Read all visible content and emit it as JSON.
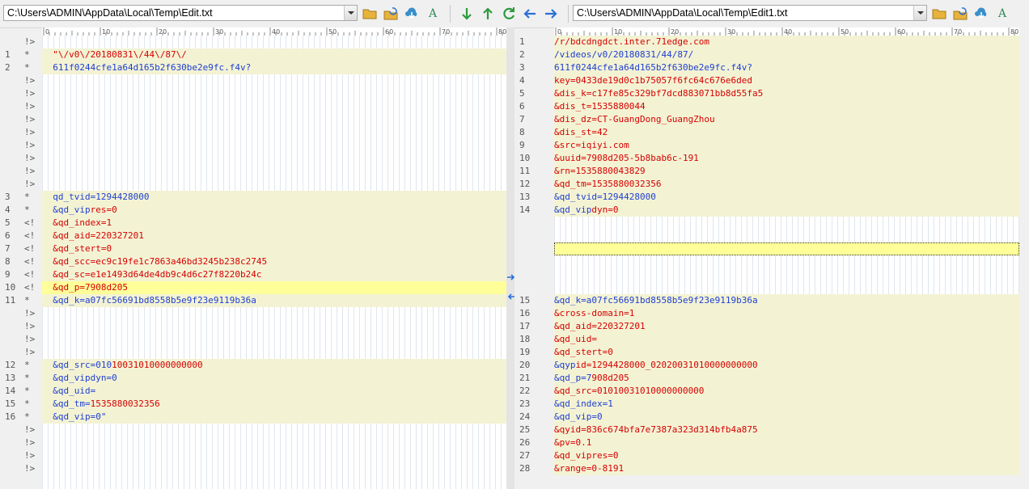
{
  "left": {
    "path": "C:\\Users\\ADMIN\\AppData\\Local\\Temp\\Edit.txt",
    "rows": [
      {
        "n": "",
        "m": "!>",
        "t": "blank",
        "k": "",
        "v": ""
      },
      {
        "n": "1",
        "m": "*",
        "t": "line",
        "k": "",
        "v": "  \"\\/v0\\/20180831\\/44\\/87\\/"
      },
      {
        "n": "2",
        "m": "*",
        "t": "line",
        "k": "  611f0244cfe1a64d165b2f630be2e9fc.f4v?",
        "v": ""
      },
      {
        "n": "",
        "m": "!>",
        "t": "blank",
        "k": "",
        "v": ""
      },
      {
        "n": "",
        "m": "!>",
        "t": "blank",
        "k": "",
        "v": ""
      },
      {
        "n": "",
        "m": "!>",
        "t": "blank",
        "k": "",
        "v": ""
      },
      {
        "n": "",
        "m": "!>",
        "t": "blank",
        "k": "",
        "v": ""
      },
      {
        "n": "",
        "m": "!>",
        "t": "blank",
        "k": "",
        "v": ""
      },
      {
        "n": "",
        "m": "!>",
        "t": "blank",
        "k": "",
        "v": ""
      },
      {
        "n": "",
        "m": "!>",
        "t": "blank",
        "k": "",
        "v": ""
      },
      {
        "n": "",
        "m": "!>",
        "t": "blank",
        "k": "",
        "v": ""
      },
      {
        "n": "",
        "m": "!>",
        "t": "blank",
        "k": "",
        "v": ""
      },
      {
        "n": "3",
        "m": "*",
        "t": "line",
        "k": "  qd_tvid=1294428000",
        "v": ""
      },
      {
        "n": "4",
        "m": "*",
        "t": "line",
        "k": "  &qd_vip",
        "v": "res=0"
      },
      {
        "n": "5",
        "m": "<!",
        "t": "line",
        "k": "",
        "v": "  &qd_index=1"
      },
      {
        "n": "6",
        "m": "<!",
        "t": "line",
        "k": "",
        "v": "  &qd_aid=220327201"
      },
      {
        "n": "7",
        "m": "<!",
        "t": "line",
        "k": "",
        "v": "  &qd_stert=0"
      },
      {
        "n": "8",
        "m": "<!",
        "t": "line",
        "k": "",
        "v": "  &qd_scc=ec9c19fe1c7863a46bd3245b238c2745"
      },
      {
        "n": "9",
        "m": "<!",
        "t": "line",
        "k": "",
        "v": "  &qd_sc=e1e1493d64de4db9c4d6c27f8220b24c"
      },
      {
        "n": "10",
        "m": "<!",
        "t": "hl",
        "k": "",
        "v": "  &qd_p=7908d205"
      },
      {
        "n": "11",
        "m": "*",
        "t": "line",
        "k": "  &qd_k=a07fc56691bd8558b5e9f23e9119b36a",
        "v": ""
      },
      {
        "n": "",
        "m": "!>",
        "t": "blank",
        "k": "",
        "v": ""
      },
      {
        "n": "",
        "m": "!>",
        "t": "blank",
        "k": "",
        "v": ""
      },
      {
        "n": "",
        "m": "!>",
        "t": "blank",
        "k": "",
        "v": ""
      },
      {
        "n": "",
        "m": "!>",
        "t": "blank",
        "k": "",
        "v": ""
      },
      {
        "n": "12",
        "m": "*",
        "t": "line",
        "k": "  &qd_src=010",
        "v": "10031010000000000"
      },
      {
        "n": "13",
        "m": "*",
        "t": "line",
        "k": "  &qd_vipdyn=0",
        "v": ""
      },
      {
        "n": "14",
        "m": "*",
        "t": "line",
        "k": "  &qd_uid=",
        "v": ""
      },
      {
        "n": "15",
        "m": "*",
        "t": "line",
        "k": "  &qd_tm=",
        "v": "1535880032356"
      },
      {
        "n": "16",
        "m": "*",
        "t": "line",
        "k": "  &qd_vip=0\"",
        "v": ""
      },
      {
        "n": "",
        "m": "!>",
        "t": "blank",
        "k": "",
        "v": ""
      },
      {
        "n": "",
        "m": "!>",
        "t": "blank",
        "k": "",
        "v": ""
      },
      {
        "n": "",
        "m": "!>",
        "t": "blank",
        "k": "",
        "v": ""
      },
      {
        "n": "",
        "m": "!>",
        "t": "blank",
        "k": "",
        "v": ""
      }
    ]
  },
  "right": {
    "path": "C:\\Users\\ADMIN\\AppData\\Local\\Temp\\Edit1.txt",
    "rows": [
      {
        "n": "1",
        "t": "line",
        "k": "",
        "v": "/r/bdcdngdct.inter.71edge.com"
      },
      {
        "n": "2",
        "t": "line",
        "k": "/videos/v0/20180831/44/87/",
        "v": ""
      },
      {
        "n": "3",
        "t": "line",
        "k": "611f0244cfe1a64d165b2f630be2e9fc.f4v?",
        "v": ""
      },
      {
        "n": "4",
        "t": "line",
        "k": "",
        "v": "key=0433de19d0c1b75057f6fc64c676e6ded"
      },
      {
        "n": "5",
        "t": "line",
        "k": "",
        "v": "&dis_k=c17fe85c329bf7dcd883071bb8d55fa5"
      },
      {
        "n": "6",
        "t": "line",
        "k": "",
        "v": "&dis_t=1535880044"
      },
      {
        "n": "7",
        "t": "line",
        "k": "",
        "v": "&dis_dz=CT-GuangDong_GuangZhou"
      },
      {
        "n": "8",
        "t": "line",
        "k": "",
        "v": "&dis_st=42"
      },
      {
        "n": "9",
        "t": "line",
        "k": "",
        "v": "&src=iqiyi.com"
      },
      {
        "n": "10",
        "t": "line",
        "k": "",
        "v": "&uuid=7908d205-5b8bab6c-191"
      },
      {
        "n": "11",
        "t": "line",
        "k": "",
        "v": "&rn=1535880043829"
      },
      {
        "n": "12",
        "t": "line",
        "k": "",
        "v": "&qd_tm=1535880032356"
      },
      {
        "n": "13",
        "t": "line",
        "k": "&qd_tvid=1294428000",
        "v": ""
      },
      {
        "n": "14",
        "t": "line",
        "k": "&qd_vip",
        "v": "dyn=0"
      },
      {
        "n": "",
        "t": "blank",
        "k": "",
        "v": ""
      },
      {
        "n": "",
        "t": "blank",
        "k": "",
        "v": ""
      },
      {
        "n": "",
        "t": "focus",
        "k": "",
        "v": ""
      },
      {
        "n": "",
        "t": "blank",
        "k": "",
        "v": ""
      },
      {
        "n": "",
        "t": "blank",
        "k": "",
        "v": ""
      },
      {
        "n": "",
        "t": "blank",
        "k": "",
        "v": ""
      },
      {
        "n": "15",
        "t": "line",
        "k": "&qd_k=a07fc56691bd8558b5e9f23e9119b36a",
        "v": ""
      },
      {
        "n": "16",
        "t": "line",
        "k": "",
        "v": "&cross-domain=1"
      },
      {
        "n": "17",
        "t": "line",
        "k": "",
        "v": "&qd_aid=220327201"
      },
      {
        "n": "18",
        "t": "line",
        "k": "",
        "v": "&qd_uid="
      },
      {
        "n": "19",
        "t": "line",
        "k": "",
        "v": "&qd_stert=0"
      },
      {
        "n": "20",
        "t": "line",
        "k": "&qyp",
        "v": "id=1294428000_02020031010000000000"
      },
      {
        "n": "21",
        "t": "line",
        "k": "&qd_p=7",
        "v": "908d205"
      },
      {
        "n": "22",
        "t": "line",
        "k": "",
        "v": "&qd_src=01010031010000000000"
      },
      {
        "n": "23",
        "t": "line",
        "k": "&qd_index=1",
        "v": ""
      },
      {
        "n": "24",
        "t": "line",
        "k": "&qd_vip=0",
        "v": ""
      },
      {
        "n": "25",
        "t": "line",
        "k": "",
        "v": "&qyid=836c674bfa7e7387a323d314bfb4a875"
      },
      {
        "n": "26",
        "t": "line",
        "k": "",
        "v": "&pv=0.1"
      },
      {
        "n": "27",
        "t": "line",
        "k": "",
        "v": "&qd_vipres=0"
      },
      {
        "n": "28",
        "t": "line",
        "k": "",
        "v": "&range=0-8191"
      }
    ]
  },
  "ruler_labels": [
    "0",
    "10",
    "20",
    "30",
    "40",
    "50",
    "60",
    "70",
    "80"
  ],
  "icons": {
    "left_tools": [
      "folder-open-icon",
      "reload-icon",
      "cloud-download-icon",
      "font-icon"
    ],
    "center_tools": [
      "next-diff-icon",
      "prev-diff-icon",
      "refresh-compare-icon",
      "copy-left-icon",
      "copy-right-icon"
    ],
    "right_tools": [
      "folder-open-icon",
      "reload-icon",
      "cloud-download-icon",
      "font-icon"
    ]
  },
  "colors": {
    "key": "#1f3ed1",
    "value": "#d60000",
    "line_bg": "#f3f3d4",
    "highlight_bg": "#ffff9a"
  }
}
